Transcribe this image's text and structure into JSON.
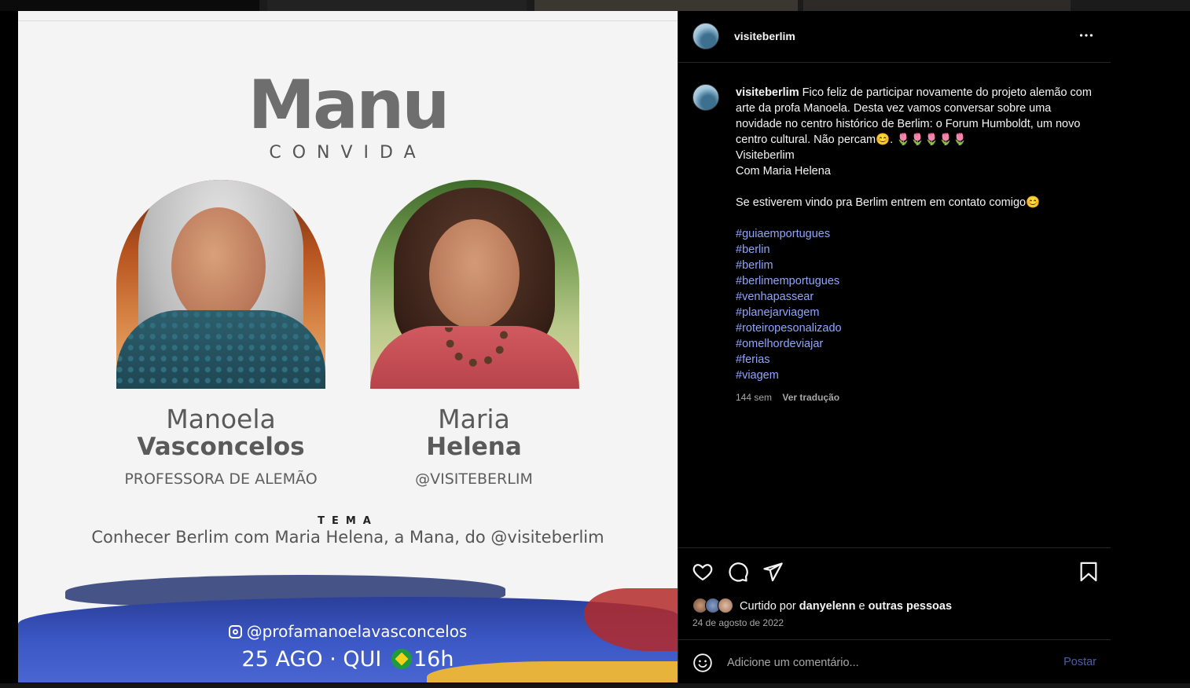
{
  "post": {
    "headline": "Manu",
    "subheadline": "CONVIDA",
    "guests": [
      {
        "first": "Manoela",
        "last": "Vasconcelos",
        "role": "PROFESSORA DE ALEMÃO"
      },
      {
        "first": "Maria",
        "last": "Helena",
        "role": "@VISITEBERLIM"
      }
    ],
    "tema_label": "TEMA",
    "tema_text": "Conhecer Berlim com Maria Helena, a Mana, do @visiteberlim",
    "instagram_handle": "@profamanoelavasconcelos",
    "event_date": "25 AGO · QUI",
    "event_time": "16h"
  },
  "panel": {
    "username": "visiteberlim",
    "more_icon": "more-horizontal-icon",
    "caption": {
      "username": "visiteberlim",
      "text_lines": [
        "Fico feliz de participar novamente do projeto alemão com arte da profa Manoela. Desta vez vamos conversar sobre uma novidade no centro histórico de Berlim: o Forum Humboldt, um novo centro cultural. Não percam😊. 🌷🌷🌷🌷🌷",
        "Visiteberlim",
        "Com Maria Helena"
      ],
      "contact_line": "Se estiverem vindo pra Berlim entrem em contato comigo😊",
      "hashtags": [
        "#guiaemportugues",
        "#berlin",
        "#berlim",
        "#berlimemportugues",
        "#venhapassear",
        "#planejarviagem",
        "#roteiropesonalizado",
        "#omelhordeviajar",
        "#ferias",
        "#viagem"
      ],
      "time_ago": "144 sem",
      "translate_label": "Ver tradução"
    },
    "actions": {
      "like_icon": "heart-icon",
      "comment_icon": "comment-icon",
      "share_icon": "send-icon",
      "save_icon": "bookmark-icon"
    },
    "likes": {
      "prefix": "Curtido por",
      "user": "danyelenn",
      "connector": "e",
      "others": "outras pessoas"
    },
    "date": "24 de agosto de 2022",
    "comment": {
      "placeholder": "Adicione um comentário...",
      "post_label": "Postar",
      "emoji_icon": "emoji-icon"
    }
  },
  "colors": {
    "panel_bg": "#000000",
    "text": "#f5f5f5",
    "muted": "#a8a8a8",
    "hashtag": "#8fa6ff",
    "post_button": "#4a5fa8"
  }
}
